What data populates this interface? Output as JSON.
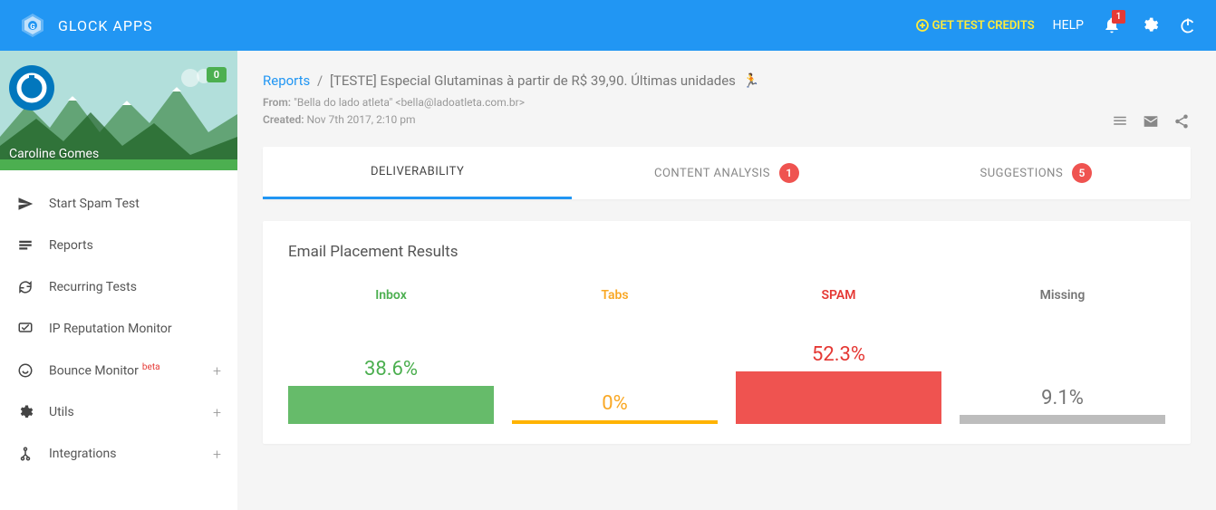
{
  "header": {
    "app_title": "GLOCK APPS",
    "credits_label": "GET TEST CREDITS",
    "help_label": "HELP",
    "notification_badge": "1"
  },
  "profile": {
    "badge": "0",
    "name": "Caroline Gomes"
  },
  "nav": {
    "items": [
      {
        "label": "Start Spam Test",
        "icon": "paper-plane",
        "expandable": false
      },
      {
        "label": "Reports",
        "icon": "reports",
        "expandable": false
      },
      {
        "label": "Recurring Tests",
        "icon": "refresh",
        "expandable": false
      },
      {
        "label": "IP Reputation Monitor",
        "icon": "monitor",
        "expandable": false
      },
      {
        "label": "Bounce Monitor",
        "icon": "bounce",
        "expandable": true,
        "beta": "beta"
      },
      {
        "label": "Utils",
        "icon": "gear",
        "expandable": true
      },
      {
        "label": "Integrations",
        "icon": "integrations",
        "expandable": true
      }
    ]
  },
  "breadcrumb": {
    "root": "Reports",
    "separator": "/",
    "title": "[TESTE] Especial Glutaminas à partir de R$ 39,90. Últimas unidades"
  },
  "meta": {
    "from_label": "From:",
    "from_value": "\"Bella do lado atleta\" <bella@ladoatleta.com.br>",
    "created_label": "Created:",
    "created_value": "Nov 7th 2017, 2:10 pm"
  },
  "tabs": [
    {
      "label": "DELIVERABILITY",
      "badge": null,
      "active": true
    },
    {
      "label": "CONTENT ANALYSIS",
      "badge": "1",
      "active": false
    },
    {
      "label": "SUGGESTIONS",
      "badge": "5",
      "active": false
    }
  ],
  "results": {
    "title": "Email Placement Results"
  },
  "chart_data": {
    "type": "bar",
    "categories": [
      "Inbox",
      "Tabs",
      "SPAM",
      "Missing"
    ],
    "values": [
      38.6,
      0,
      52.3,
      9.1
    ],
    "display_values": [
      "38.6%",
      "0%",
      "52.3%",
      "9.1%"
    ],
    "colors": [
      "#4caf50",
      "#f9a825",
      "#e53935",
      "#757575"
    ],
    "ylim": [
      0,
      100
    ],
    "title": "Email Placement Results"
  }
}
